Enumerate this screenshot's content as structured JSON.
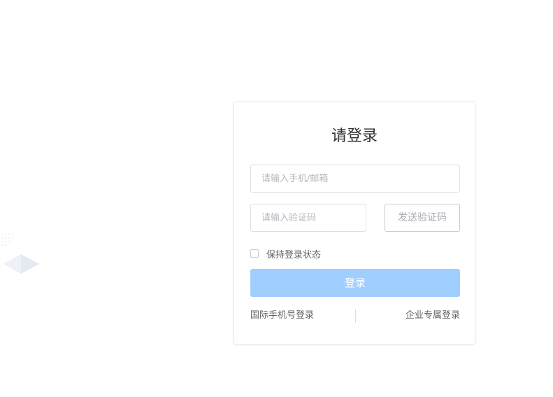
{
  "login": {
    "title": "请登录",
    "account_placeholder": "请输入手机/邮箱",
    "code_placeholder": "请输入验证码",
    "send_code_label": "发送验证码",
    "remember_label": "保持登录状态",
    "remember_checked": false,
    "submit_label": "登录",
    "international_login_label": "国际手机号登录",
    "enterprise_login_label": "企业专属登录"
  },
  "colors": {
    "primary_disabled": "#a0cfff",
    "border": "#dcdfe6",
    "text": "#606266",
    "title": "#303133"
  }
}
